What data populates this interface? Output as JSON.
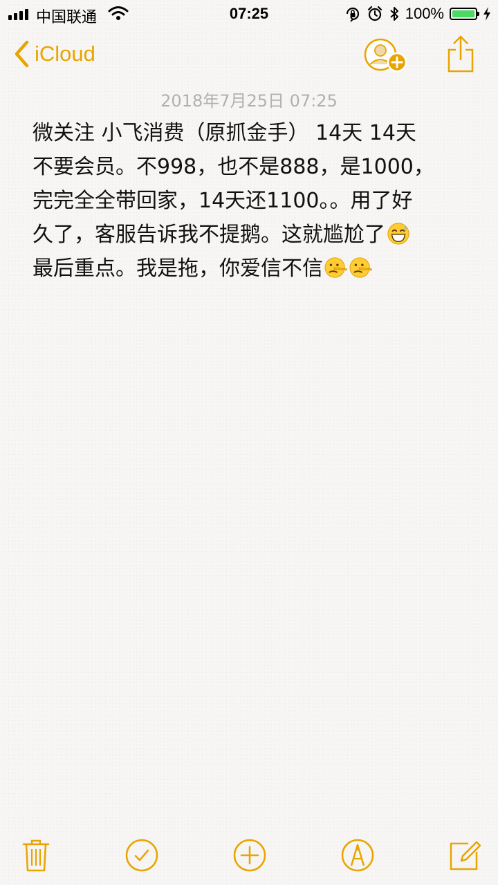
{
  "status_bar": {
    "carrier": "中国联通",
    "time": "07:25",
    "battery_percent": "100%",
    "battery_level": 1.0,
    "icons": [
      "signal-icon",
      "wifi-icon",
      "orientation-lock-icon",
      "alarm-icon",
      "bluetooth-icon",
      "battery-icon",
      "charging-icon"
    ]
  },
  "nav": {
    "back_label": "iCloud",
    "icons": [
      "chevron-left-icon",
      "add-person-icon",
      "share-icon"
    ]
  },
  "note": {
    "date": "2018年7月25日 07:25",
    "lines": [
      "微关注 小飞消费（原抓金手） 14天 14天",
      "不要会员。不998，也不是888，是1000，",
      "完完全全带回家，14天还1100。。用了好",
      "久了，客服告诉我不提鹅。这就尴尬了",
      "最后重点。我是拖，你爱信不信"
    ],
    "emoji": [
      "grinning-sweat-emoji",
      "lying-face-emoji",
      "lying-face-emoji"
    ]
  },
  "toolbar": {
    "icons": [
      "trash-icon",
      "checklist-icon",
      "add-icon",
      "markup-icon",
      "compose-icon"
    ]
  },
  "colors": {
    "accent": "#e8a400",
    "date_text": "#b0b0b0",
    "battery": "#4cd964"
  }
}
